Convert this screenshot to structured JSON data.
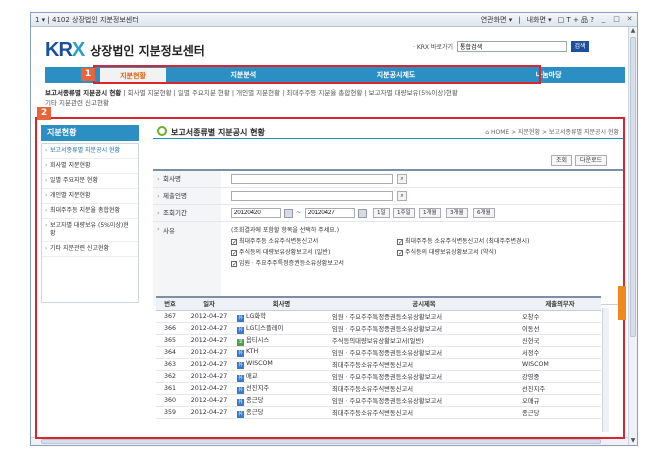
{
  "window": {
    "title": "1 ▾ | 4102 상장법인 지분정보센터",
    "menu_related": "연관화면 ▾",
    "menu_my": "내화면 ▾",
    "controls": "□ T + 品 ?"
  },
  "header": {
    "logo_text": "KRX",
    "site_title": "상장법인 지분정보센터",
    "search_label": "· KRX 바로가기",
    "search_value": "통합검색",
    "search_button": "검색"
  },
  "nav": {
    "items": [
      "지분현황",
      "지분분석",
      "지분공시제도",
      "나눔마당"
    ]
  },
  "annotations": {
    "badge1": "1",
    "badge2": "2"
  },
  "subnav": {
    "line1_bold": "보고서종류별 지분공시 현황",
    "line1_rest": " | 회사별 지분현황 | 일별 주요지분 현황 | 개인별 지분현황 | 최대주주등 지분율 총합현황 | 보고자별 대량보유(5%이상)현황",
    "line2": "기타 지분관련 신고현황"
  },
  "sidebar": {
    "heading": "지분현황",
    "items": [
      "보고서종류별 지분공시 현황",
      "회사별 지분현황",
      "일별 주요지분 현황",
      "개인별 지분현황",
      "최대주주등 지분율 총합현황",
      "보고자별 대량보유 (5%이상)현황",
      "기타 지분관련 신고현황"
    ]
  },
  "page": {
    "title": "보고서종류별 지분공시 현황",
    "breadcrumb": "⌂ HOME > 지분현황 > 보고서종류별 지분공시 현황",
    "btn_search": "조회",
    "btn_download": "다운로드"
  },
  "form": {
    "company_label": "회사명",
    "submitter_label": "제출인명",
    "period_label": "조회기간",
    "date_from": "20120420",
    "date_to": "20120427",
    "period_buttons": [
      "1일",
      "1주일",
      "1개월",
      "3개월",
      "6개월"
    ],
    "reason_label": "사유",
    "reason_hint": "(조회결과에 포함할 항목을 선택하 주세요.)",
    "checks": [
      "최대주주등 소유주식변동신고서",
      "최대주주등 소유주식변동신고서 (최대주주변경시)",
      "주식등의 대량보유상황보고서 (일반)",
      "주식등의 대량보유상황보고서 (약식)",
      "임원ㆍ주요주주특정증권등소유상황보고서"
    ]
  },
  "table": {
    "headers": [
      "번호",
      "일자",
      "회사명",
      "공시제목",
      "제출의무자"
    ],
    "rows": [
      {
        "no": "367",
        "date": "2012-04-27",
        "tag": "유",
        "company": "LG화학",
        "title": "임원ㆍ주요주주특정증권등소유상황보고서",
        "filer": "오창수"
      },
      {
        "no": "366",
        "date": "2012-04-27",
        "tag": "유",
        "company": "LG디스플레이",
        "title": "임원ㆍ주요주주특정증권등소유상황보고서",
        "filer": "이동선"
      },
      {
        "no": "365",
        "date": "2012-04-27",
        "tag": "코",
        "company": "옵티시스",
        "title": "주식등의대량보유상황보고서(일반)",
        "filer": "신현국"
      },
      {
        "no": "364",
        "date": "2012-04-27",
        "tag": "유",
        "company": "KTH",
        "title": "임원ㆍ주요주주특정증권등소유상황보고서",
        "filer": "서정수"
      },
      {
        "no": "363",
        "date": "2012-04-27",
        "tag": "유",
        "company": "WISCOM",
        "title": "최대주주등소유주식변동신고서",
        "filer": "WISCOM"
      },
      {
        "no": "362",
        "date": "2012-04-27",
        "tag": "유",
        "company": "매교",
        "title": "임원ㆍ주요주주특정증권등소유상황보고서",
        "filer": "강영중"
      },
      {
        "no": "361",
        "date": "2012-04-27",
        "tag": "유",
        "company": "선진지주",
        "title": "최대주주등소유주식변동신고서",
        "filer": "선진지주"
      },
      {
        "no": "360",
        "date": "2012-04-27",
        "tag": "유",
        "company": "종근당",
        "title": "임원ㆍ주요주주특정증권등소유상황보고서",
        "filer": "오매규"
      },
      {
        "no": "359",
        "date": "2012-04-27",
        "tag": "유",
        "company": "종근당",
        "title": "최대주주등소유주식변동신고서",
        "filer": "종근당"
      }
    ]
  },
  "colors": {
    "accent": "#2c8fc4",
    "highlight": "#d9252b",
    "badge": "#e8643a",
    "active_tab": "#e06010"
  }
}
